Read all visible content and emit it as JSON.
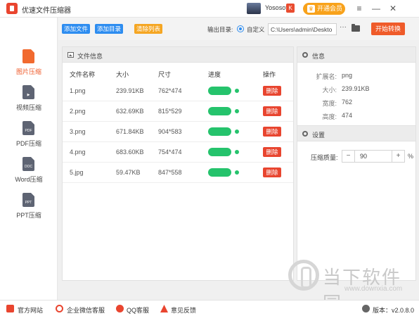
{
  "app": {
    "title": "优速文件压缩器",
    "user_name": "Yososoft",
    "user_badge": "K",
    "vip_label": "开通会员",
    "vip_icon": "crown-icon"
  },
  "window": {
    "menu": "≡",
    "minimize": "—",
    "close": "✕"
  },
  "sidebar": {
    "items": [
      {
        "label": "图片压缩",
        "icon": "image-file-icon",
        "tag": ""
      },
      {
        "label": "视频压缩",
        "icon": "video-file-icon",
        "tag": "▶"
      },
      {
        "label": "PDF压缩",
        "icon": "pdf-file-icon",
        "tag": "PDF"
      },
      {
        "label": "Word压缩",
        "icon": "doc-file-icon",
        "tag": "DOC"
      },
      {
        "label": "PPT压缩",
        "icon": "ppt-file-icon",
        "tag": "PPT"
      }
    ]
  },
  "toolbar": {
    "add_file": "添加文件",
    "add_dir": "添加目录",
    "clear_list": "清除列表",
    "output_label": "输出目录:",
    "radio_label": "自定义",
    "output_path": "C:\\Users\\admin\\Deskto",
    "more": "···",
    "start": "开始转换"
  },
  "file_panel": {
    "title": "文件信息",
    "columns": [
      "文件名称",
      "大小",
      "尺寸",
      "进度",
      "操作"
    ],
    "delete_label": "删除",
    "rows": [
      {
        "name": "1.png",
        "size": "239.91KB",
        "dim": "762*474",
        "progress": 1.0
      },
      {
        "name": "2.png",
        "size": "632.69KB",
        "dim": "815*529",
        "progress": 1.0
      },
      {
        "name": "3.png",
        "size": "671.84KB",
        "dim": "904*583",
        "progress": 1.0
      },
      {
        "name": "4.png",
        "size": "683.60KB",
        "dim": "754*474",
        "progress": 1.0
      },
      {
        "name": "5.jpg",
        "size": "59.47KB",
        "dim": "847*558",
        "progress": 1.0
      }
    ]
  },
  "info": {
    "title": "信息",
    "fields": [
      {
        "key": "扩展名:",
        "value": "png"
      },
      {
        "key": "大小:",
        "value": "239.91KB"
      },
      {
        "key": "宽度:",
        "value": "762"
      },
      {
        "key": "高度:",
        "value": "474"
      }
    ]
  },
  "settings": {
    "title": "设置",
    "quality_label": "压缩质量:",
    "quality_value": "90",
    "minus": "−",
    "plus": "+",
    "unit": "%"
  },
  "watermark": {
    "title": "当下软件园",
    "url": "www.downxia.com"
  },
  "bottom": {
    "website": "官方网站",
    "wechat": "企业微信客服",
    "qq": "QQ客服",
    "feedback": "意见反馈",
    "version": "版本：v2.0.8.0"
  },
  "colors": {
    "accent": "#ef5b2a",
    "blue": "#2e8df0",
    "orange": "#f5a623",
    "green": "#25c36c",
    "delete": "#e8452f"
  }
}
